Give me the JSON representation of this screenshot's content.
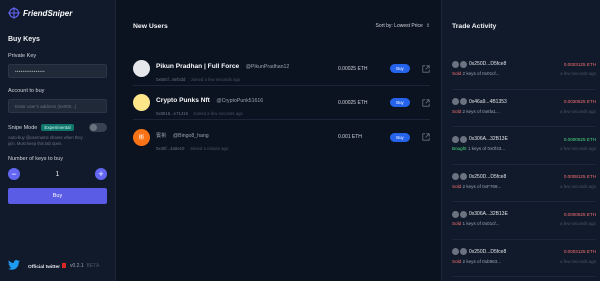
{
  "app": {
    "name": "FriendSniper"
  },
  "sidebar": {
    "title": "Buy Keys",
    "private_key_label": "Private Key",
    "private_key_value": "••••••••••••••••",
    "account_label": "Account to buy",
    "account_placeholder": "Enter user's address (0x000...)",
    "snipe_label": "Snipe Mode",
    "snipe_badge": "Experimental",
    "snipe_description": "Auto-buy @username shares when they join. Must keep this tab open.",
    "keys_label": "Number of keys to buy",
    "keys_value": "1",
    "minus_symbol": "−",
    "plus_symbol": "+",
    "buy_label": "Buy",
    "twitter_label": "Official twitter",
    "version": "v0.2.1",
    "beta": "BETA"
  },
  "new_users": {
    "title": "New Users",
    "sort_label": "Sort by: Lowest Price",
    "buy_label": "Buy",
    "items": [
      {
        "name": "Pikun Pradhan | Full Force",
        "handle": "@PikunPradhan12",
        "address": "0x60cf...8ef2dd",
        "joined": "Joined a few seconds ago",
        "price": "0.00025 ETH",
        "avatar_color": "#e5e7eb",
        "avatar_text": ""
      },
      {
        "name": "Crypto Punks Nft",
        "handle": "@CryptoPunk51616",
        "address": "0x8915...e71415",
        "joined": "Joined a few seconds ago",
        "price": "0.00025 ETH",
        "avatar_color": "#fde68a",
        "avatar_text": ""
      },
      {
        "name": "賓彬",
        "handle": "@Bingo8_hang",
        "address": "0x40f...4a0e10",
        "joined": "Joined a minute ago",
        "price": "0.001 ETH",
        "avatar_color": "#f97316",
        "avatar_text": "彬"
      }
    ]
  },
  "trade_activity": {
    "title": "Trade Activity",
    "items": [
      {
        "pair": "0x250D...D5fce8",
        "price": "0.0003125 ETH",
        "action": "Sold",
        "keys": "2 keys of",
        "target": "0x01cf...",
        "time": "a few seconds ago",
        "type": "sell"
      },
      {
        "pair": "0x46a9...4B1353",
        "price": "0.0030625 ETH",
        "action": "Sold",
        "keys": "2 keys of",
        "target": "0x6fa1...",
        "time": "a few seconds ago",
        "type": "sell"
      },
      {
        "pair": "0x306A...32B13E",
        "price": "0.0000625 ETH",
        "action": "Bought",
        "keys": "1 keys of",
        "target": "0x0f43...",
        "time": "a few seconds ago",
        "type": "buy"
      },
      {
        "pair": "0x250D...D5fce8",
        "price": "0.0008125 ETH",
        "action": "Sold",
        "keys": "2 keys of",
        "target": "0xF769...",
        "time": "a few seconds ago",
        "type": "sell"
      },
      {
        "pair": "0x306A...32B13E",
        "price": "0.0000625 ETH",
        "action": "Sold",
        "keys": "1 keys of",
        "target": "0x01cf...",
        "time": "a few seconds ago",
        "type": "sell"
      },
      {
        "pair": "0x250D...D5fce8",
        "price": "0.0003125 ETH",
        "action": "Sold",
        "keys": "2 keys of",
        "target": "0xb963...",
        "time": "a few seconds ago",
        "type": "sell"
      }
    ]
  }
}
